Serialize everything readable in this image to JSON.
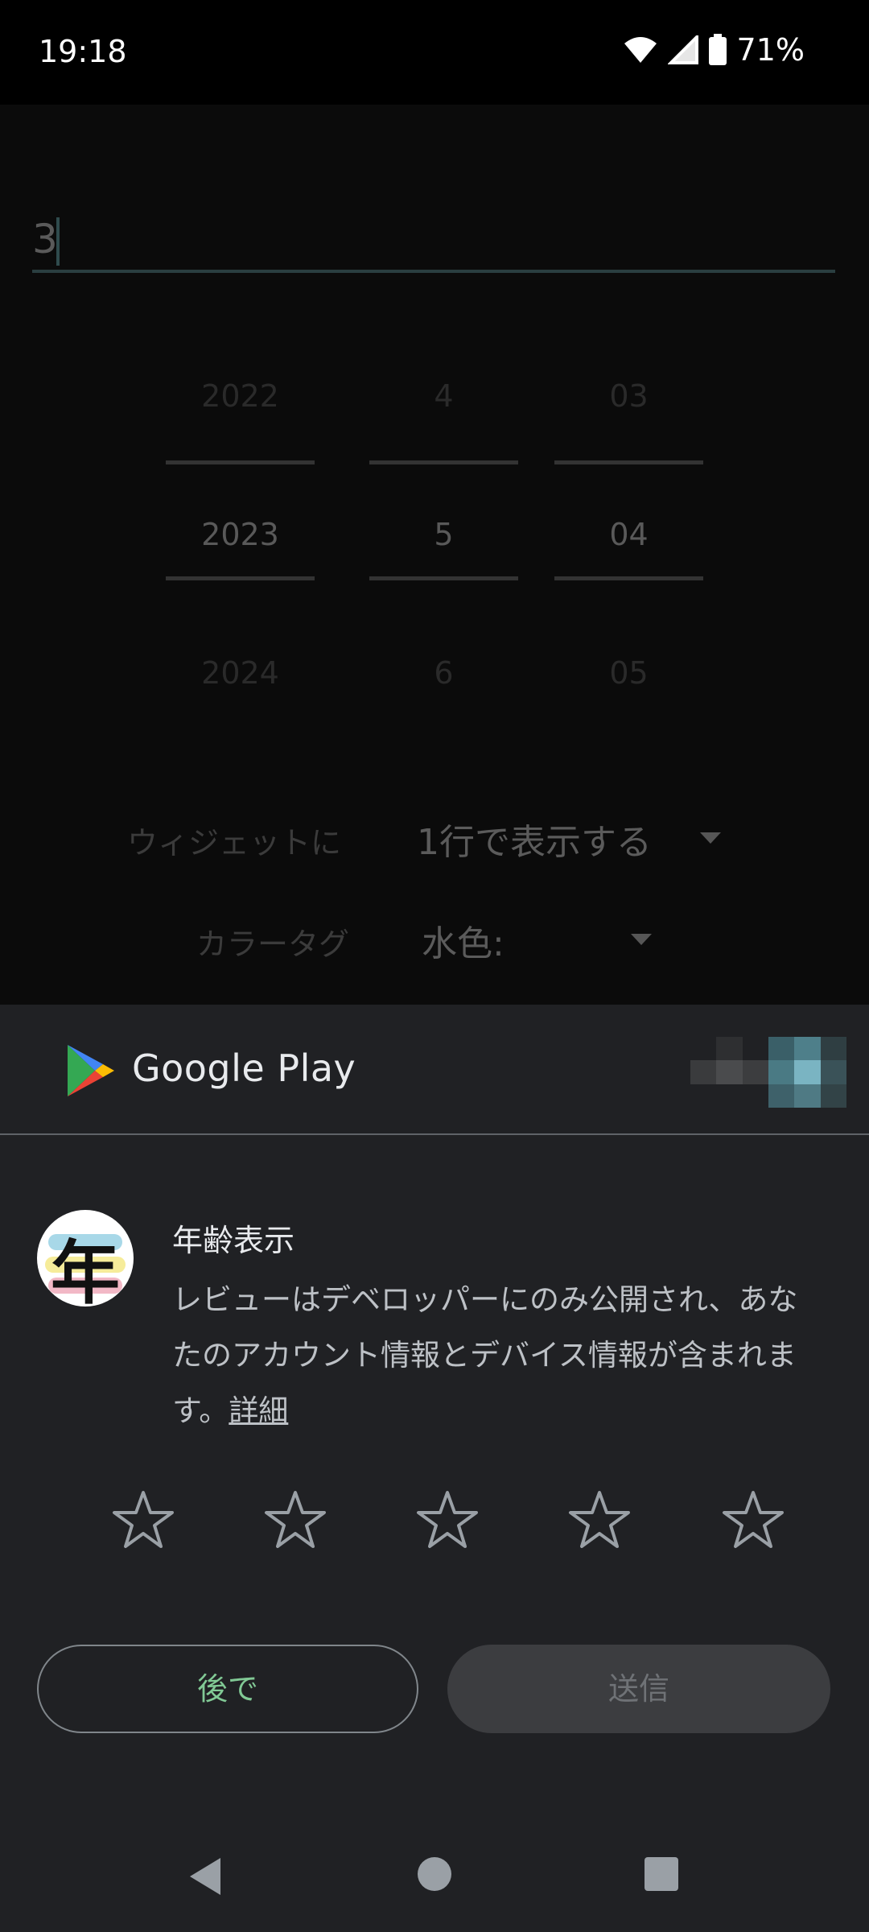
{
  "status_bar": {
    "time": "19:18",
    "battery": "71%"
  },
  "background_app": {
    "text_input_value": "3",
    "date_picker": {
      "year": {
        "prev": "2022",
        "current": "2023",
        "next": "2024"
      },
      "month": {
        "prev": "4",
        "current": "5",
        "next": "6"
      },
      "day": {
        "prev": "03",
        "current": "04",
        "next": "05"
      }
    },
    "widget_setting": {
      "label": "ウィジェットに",
      "value": "1行で表示する"
    },
    "color_tag": {
      "label": "カラータグ",
      "value": "水色:"
    }
  },
  "review_sheet": {
    "store_name": "Google Play",
    "app_name": "年齢表示",
    "app_icon_glyph": "年",
    "disclaimer": "レビューはデベロッパーにのみ公開され、あなたのアカウント情報とデバイス情報が含まれます。",
    "details_link": "詳細",
    "star_count": 5,
    "later_button": "後で",
    "send_button": "送信",
    "colors": {
      "accent_green": "#81c995",
      "sheet_bg": "#202124"
    }
  },
  "nav_bar": {
    "icons": [
      "back-icon",
      "home-icon",
      "recents-icon"
    ]
  }
}
